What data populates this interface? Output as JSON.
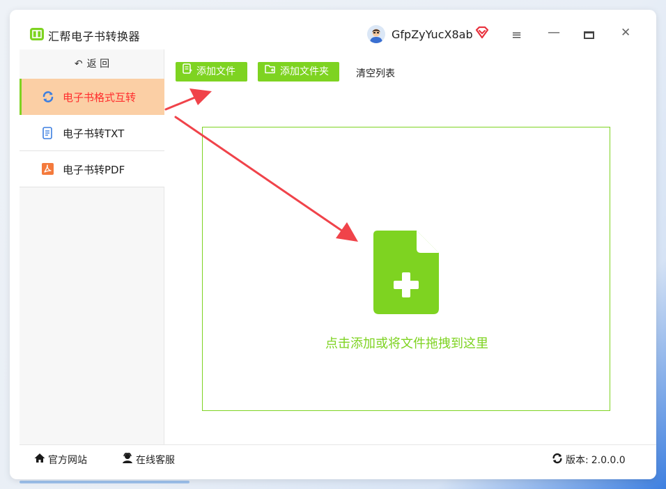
{
  "app": {
    "title": "汇帮电子书转换器",
    "username": "GfpZyYucX8ab",
    "accent_color": "#7ed321",
    "active_bg_color": "#fbcfa5",
    "active_text_color": "#ff2d2d"
  },
  "window_controls": {
    "menu_icon": "hamburger-icon",
    "minimize_icon": "minimize-icon",
    "maximize_icon": "maximize-icon",
    "close_icon": "close-icon"
  },
  "sidebar": {
    "back_label": "返 回",
    "items": [
      {
        "label": "电子书格式互转",
        "icon": "refresh-icon",
        "active": true
      },
      {
        "label": "电子书转TXT",
        "icon": "text-document-icon",
        "active": false
      },
      {
        "label": "电子书转PDF",
        "icon": "pdf-icon",
        "active": false
      }
    ]
  },
  "toolbar": {
    "add_file_label": "添加文件",
    "add_folder_label": "添加文件夹",
    "clear_list_label": "清空列表"
  },
  "dropzone": {
    "hint": "点击添加或将文件拖拽到这里",
    "icon": "add-file-icon"
  },
  "footer": {
    "website_label": "官方网站",
    "support_label": "在线客服",
    "version_label": "版本:",
    "version_value": "2.0.0.0"
  }
}
